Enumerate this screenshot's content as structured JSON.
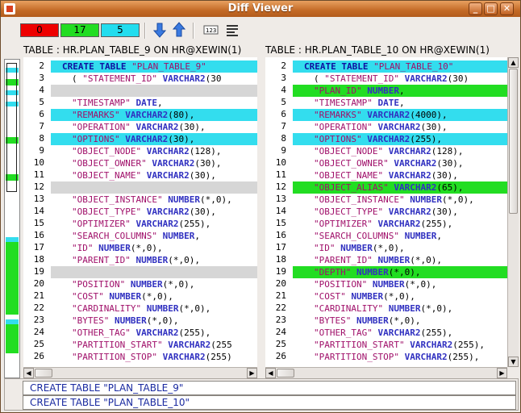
{
  "window": {
    "title": "Diff Viewer"
  },
  "toolbar": {
    "counters": [
      {
        "label": "0",
        "color": "#ee0000"
      },
      {
        "label": "17",
        "color": "#22dd22"
      },
      {
        "label": "5",
        "color": "#22ddee"
      }
    ],
    "buttons": [
      "arrow-down-icon",
      "arrow-up-icon",
      "line-numbers-icon",
      "wrap-icon"
    ]
  },
  "left": {
    "header": "TABLE : HR.PLAN_TABLE_9 ON HR@XEWIN(1)",
    "lines": [
      {
        "n": "2",
        "hl": "cyan",
        "t": [
          [
            "kw",
            "CREATE TABLE "
          ],
          [
            "str",
            "\"PLAN_TABLE_9\""
          ]
        ]
      },
      {
        "n": "3",
        "hl": "",
        "t": [
          [
            "plain",
            "  (    "
          ],
          [
            "str",
            "\"STATEMENT_ID\" "
          ],
          [
            "kwsql",
            "VARCHAR2"
          ],
          [
            "plain",
            "(30"
          ]
        ]
      },
      {
        "n": "4",
        "hl": "gray",
        "t": []
      },
      {
        "n": "5",
        "hl": "",
        "t": [
          [
            "str",
            "\"TIMESTAMP\" "
          ],
          [
            "kwsql",
            "DATE"
          ],
          [
            "plain",
            ","
          ]
        ]
      },
      {
        "n": "6",
        "hl": "cyan",
        "t": [
          [
            "str",
            "\"REMARKS\" "
          ],
          [
            "kwsql",
            "VARCHAR2"
          ],
          [
            "plain",
            "(80),"
          ]
        ]
      },
      {
        "n": "7",
        "hl": "",
        "t": [
          [
            "str",
            "\"OPERATION\" "
          ],
          [
            "kwsql",
            "VARCHAR2"
          ],
          [
            "plain",
            "(30),"
          ]
        ]
      },
      {
        "n": "8",
        "hl": "cyan",
        "t": [
          [
            "str",
            "\"OPTIONS\" "
          ],
          [
            "kwsql",
            "VARCHAR2"
          ],
          [
            "plain",
            "(30),"
          ]
        ]
      },
      {
        "n": "9",
        "hl": "",
        "t": [
          [
            "str",
            "\"OBJECT_NODE\" "
          ],
          [
            "kwsql",
            "VARCHAR2"
          ],
          [
            "plain",
            "(128),"
          ]
        ]
      },
      {
        "n": "10",
        "hl": "",
        "t": [
          [
            "str",
            "\"OBJECT_OWNER\" "
          ],
          [
            "kwsql",
            "VARCHAR2"
          ],
          [
            "plain",
            "(30),"
          ]
        ]
      },
      {
        "n": "11",
        "hl": "",
        "t": [
          [
            "str",
            "\"OBJECT_NAME\" "
          ],
          [
            "kwsql",
            "VARCHAR2"
          ],
          [
            "plain",
            "(30),"
          ]
        ]
      },
      {
        "n": "12",
        "hl": "gray",
        "t": []
      },
      {
        "n": "13",
        "hl": "",
        "t": [
          [
            "str",
            "\"OBJECT_INSTANCE\" "
          ],
          [
            "kwsql",
            "NUMBER"
          ],
          [
            "plain",
            "(*,0),"
          ]
        ]
      },
      {
        "n": "14",
        "hl": "",
        "t": [
          [
            "str",
            "\"OBJECT_TYPE\" "
          ],
          [
            "kwsql",
            "VARCHAR2"
          ],
          [
            "plain",
            "(30),"
          ]
        ]
      },
      {
        "n": "15",
        "hl": "",
        "t": [
          [
            "str",
            "\"OPTIMIZER\" "
          ],
          [
            "kwsql",
            "VARCHAR2"
          ],
          [
            "plain",
            "(255),"
          ]
        ]
      },
      {
        "n": "16",
        "hl": "",
        "t": [
          [
            "str",
            "\"SEARCH_COLUMNS\" "
          ],
          [
            "kwsql",
            "NUMBER"
          ],
          [
            "plain",
            ","
          ]
        ]
      },
      {
        "n": "17",
        "hl": "",
        "t": [
          [
            "str",
            "\"ID\" "
          ],
          [
            "kwsql",
            "NUMBER"
          ],
          [
            "plain",
            "(*,0),"
          ]
        ]
      },
      {
        "n": "18",
        "hl": "",
        "t": [
          [
            "str",
            "\"PARENT_ID\" "
          ],
          [
            "kwsql",
            "NUMBER"
          ],
          [
            "plain",
            "(*,0),"
          ]
        ]
      },
      {
        "n": "19",
        "hl": "gray",
        "t": []
      },
      {
        "n": "20",
        "hl": "",
        "t": [
          [
            "str",
            "\"POSITION\" "
          ],
          [
            "kwsql",
            "NUMBER"
          ],
          [
            "plain",
            "(*,0),"
          ]
        ]
      },
      {
        "n": "21",
        "hl": "",
        "t": [
          [
            "str",
            "\"COST\" "
          ],
          [
            "kwsql",
            "NUMBER"
          ],
          [
            "plain",
            "(*,0),"
          ]
        ]
      },
      {
        "n": "22",
        "hl": "",
        "t": [
          [
            "str",
            "\"CARDINALITY\" "
          ],
          [
            "kwsql",
            "NUMBER"
          ],
          [
            "plain",
            "(*,0),"
          ]
        ]
      },
      {
        "n": "23",
        "hl": "",
        "t": [
          [
            "str",
            "\"BYTES\" "
          ],
          [
            "kwsql",
            "NUMBER"
          ],
          [
            "plain",
            "(*,0),"
          ]
        ]
      },
      {
        "n": "24",
        "hl": "",
        "t": [
          [
            "str",
            "\"OTHER_TAG\" "
          ],
          [
            "kwsql",
            "VARCHAR2"
          ],
          [
            "plain",
            "(255),"
          ]
        ]
      },
      {
        "n": "25",
        "hl": "",
        "t": [
          [
            "str",
            "\"PARTITION_START\" "
          ],
          [
            "kwsql",
            "VARCHAR2"
          ],
          [
            "plain",
            "(255"
          ]
        ]
      },
      {
        "n": "26",
        "hl": "",
        "t": [
          [
            "str",
            "\"PARTITION_STOP\" "
          ],
          [
            "kwsql",
            "VARCHAR2"
          ],
          [
            "plain",
            "(255)"
          ]
        ]
      }
    ]
  },
  "right": {
    "header": "TABLE : HR.PLAN_TABLE_10 ON HR@XEWIN(1)",
    "lines": [
      {
        "n": "2",
        "hl": "cyan",
        "t": [
          [
            "kw",
            "CREATE TABLE "
          ],
          [
            "str",
            "\"PLAN_TABLE_10\""
          ]
        ]
      },
      {
        "n": "3",
        "hl": "",
        "t": [
          [
            "plain",
            "  (    "
          ],
          [
            "str",
            "\"STATEMENT_ID\" "
          ],
          [
            "kwsql",
            "VARCHAR2"
          ],
          [
            "plain",
            "(30)"
          ]
        ]
      },
      {
        "n": "4",
        "hl": "green",
        "t": [
          [
            "str",
            "\"PLAN_ID\" "
          ],
          [
            "kwsql",
            "NUMBER"
          ],
          [
            "plain",
            ","
          ]
        ]
      },
      {
        "n": "5",
        "hl": "",
        "t": [
          [
            "str",
            "\"TIMESTAMP\" "
          ],
          [
            "kwsql",
            "DATE"
          ],
          [
            "plain",
            ","
          ]
        ]
      },
      {
        "n": "6",
        "hl": "cyan",
        "t": [
          [
            "str",
            "\"REMARKS\" "
          ],
          [
            "kwsql",
            "VARCHAR2"
          ],
          [
            "plain",
            "(4000),"
          ]
        ]
      },
      {
        "n": "7",
        "hl": "",
        "t": [
          [
            "str",
            "\"OPERATION\" "
          ],
          [
            "kwsql",
            "VARCHAR2"
          ],
          [
            "plain",
            "(30),"
          ]
        ]
      },
      {
        "n": "8",
        "hl": "cyan",
        "t": [
          [
            "str",
            "\"OPTIONS\" "
          ],
          [
            "kwsql",
            "VARCHAR2"
          ],
          [
            "plain",
            "(255),"
          ]
        ]
      },
      {
        "n": "9",
        "hl": "",
        "t": [
          [
            "str",
            "\"OBJECT_NODE\" "
          ],
          [
            "kwsql",
            "VARCHAR2"
          ],
          [
            "plain",
            "(128),"
          ]
        ]
      },
      {
        "n": "10",
        "hl": "",
        "t": [
          [
            "str",
            "\"OBJECT_OWNER\" "
          ],
          [
            "kwsql",
            "VARCHAR2"
          ],
          [
            "plain",
            "(30),"
          ]
        ]
      },
      {
        "n": "11",
        "hl": "",
        "t": [
          [
            "str",
            "\"OBJECT_NAME\" "
          ],
          [
            "kwsql",
            "VARCHAR2"
          ],
          [
            "plain",
            "(30),"
          ]
        ]
      },
      {
        "n": "12",
        "hl": "green",
        "t": [
          [
            "str",
            "\"OBJECT_ALIAS\" "
          ],
          [
            "kwsql",
            "VARCHAR2"
          ],
          [
            "plain",
            "(65),"
          ]
        ]
      },
      {
        "n": "13",
        "hl": "",
        "t": [
          [
            "str",
            "\"OBJECT_INSTANCE\" "
          ],
          [
            "kwsql",
            "NUMBER"
          ],
          [
            "plain",
            "(*,0),"
          ]
        ]
      },
      {
        "n": "14",
        "hl": "",
        "t": [
          [
            "str",
            "\"OBJECT_TYPE\" "
          ],
          [
            "kwsql",
            "VARCHAR2"
          ],
          [
            "plain",
            "(30),"
          ]
        ]
      },
      {
        "n": "15",
        "hl": "",
        "t": [
          [
            "str",
            "\"OPTIMIZER\" "
          ],
          [
            "kwsql",
            "VARCHAR2"
          ],
          [
            "plain",
            "(255),"
          ]
        ]
      },
      {
        "n": "16",
        "hl": "",
        "t": [
          [
            "str",
            "\"SEARCH_COLUMNS\" "
          ],
          [
            "kwsql",
            "NUMBER"
          ],
          [
            "plain",
            ","
          ]
        ]
      },
      {
        "n": "17",
        "hl": "",
        "t": [
          [
            "str",
            "\"ID\" "
          ],
          [
            "kwsql",
            "NUMBER"
          ],
          [
            "plain",
            "(*,0),"
          ]
        ]
      },
      {
        "n": "18",
        "hl": "",
        "t": [
          [
            "str",
            "\"PARENT_ID\" "
          ],
          [
            "kwsql",
            "NUMBER"
          ],
          [
            "plain",
            "(*,0),"
          ]
        ]
      },
      {
        "n": "19",
        "hl": "green",
        "t": [
          [
            "str",
            "\"DEPTH\" "
          ],
          [
            "kwsql",
            "NUMBER"
          ],
          [
            "plain",
            "(*,0),"
          ]
        ]
      },
      {
        "n": "20",
        "hl": "",
        "t": [
          [
            "str",
            "\"POSITION\" "
          ],
          [
            "kwsql",
            "NUMBER"
          ],
          [
            "plain",
            "(*,0),"
          ]
        ]
      },
      {
        "n": "21",
        "hl": "",
        "t": [
          [
            "str",
            "\"COST\" "
          ],
          [
            "kwsql",
            "NUMBER"
          ],
          [
            "plain",
            "(*,0),"
          ]
        ]
      },
      {
        "n": "22",
        "hl": "",
        "t": [
          [
            "str",
            "\"CARDINALITY\" "
          ],
          [
            "kwsql",
            "NUMBER"
          ],
          [
            "plain",
            "(*,0),"
          ]
        ]
      },
      {
        "n": "23",
        "hl": "",
        "t": [
          [
            "str",
            "\"BYTES\" "
          ],
          [
            "kwsql",
            "NUMBER"
          ],
          [
            "plain",
            "(*,0),"
          ]
        ]
      },
      {
        "n": "24",
        "hl": "",
        "t": [
          [
            "str",
            "\"OTHER_TAG\" "
          ],
          [
            "kwsql",
            "VARCHAR2"
          ],
          [
            "plain",
            "(255),"
          ]
        ]
      },
      {
        "n": "25",
        "hl": "",
        "t": [
          [
            "str",
            "\"PARTITION_START\" "
          ],
          [
            "kwsql",
            "VARCHAR2"
          ],
          [
            "plain",
            "(255),"
          ]
        ]
      },
      {
        "n": "26",
        "hl": "",
        "t": [
          [
            "str",
            "\"PARTITION_STOP\" "
          ],
          [
            "kwsql",
            "VARCHAR2"
          ],
          [
            "plain",
            "(255),"
          ]
        ]
      }
    ]
  },
  "bottom": {
    "line1": "CREATE TABLE \"PLAN_TABLE_9\"",
    "line2": "CREATE TABLE \"PLAN_TABLE_10\""
  },
  "colors": {
    "cyan": "#33ddee",
    "green": "#22dd22",
    "gray": "#d6d6d6"
  }
}
